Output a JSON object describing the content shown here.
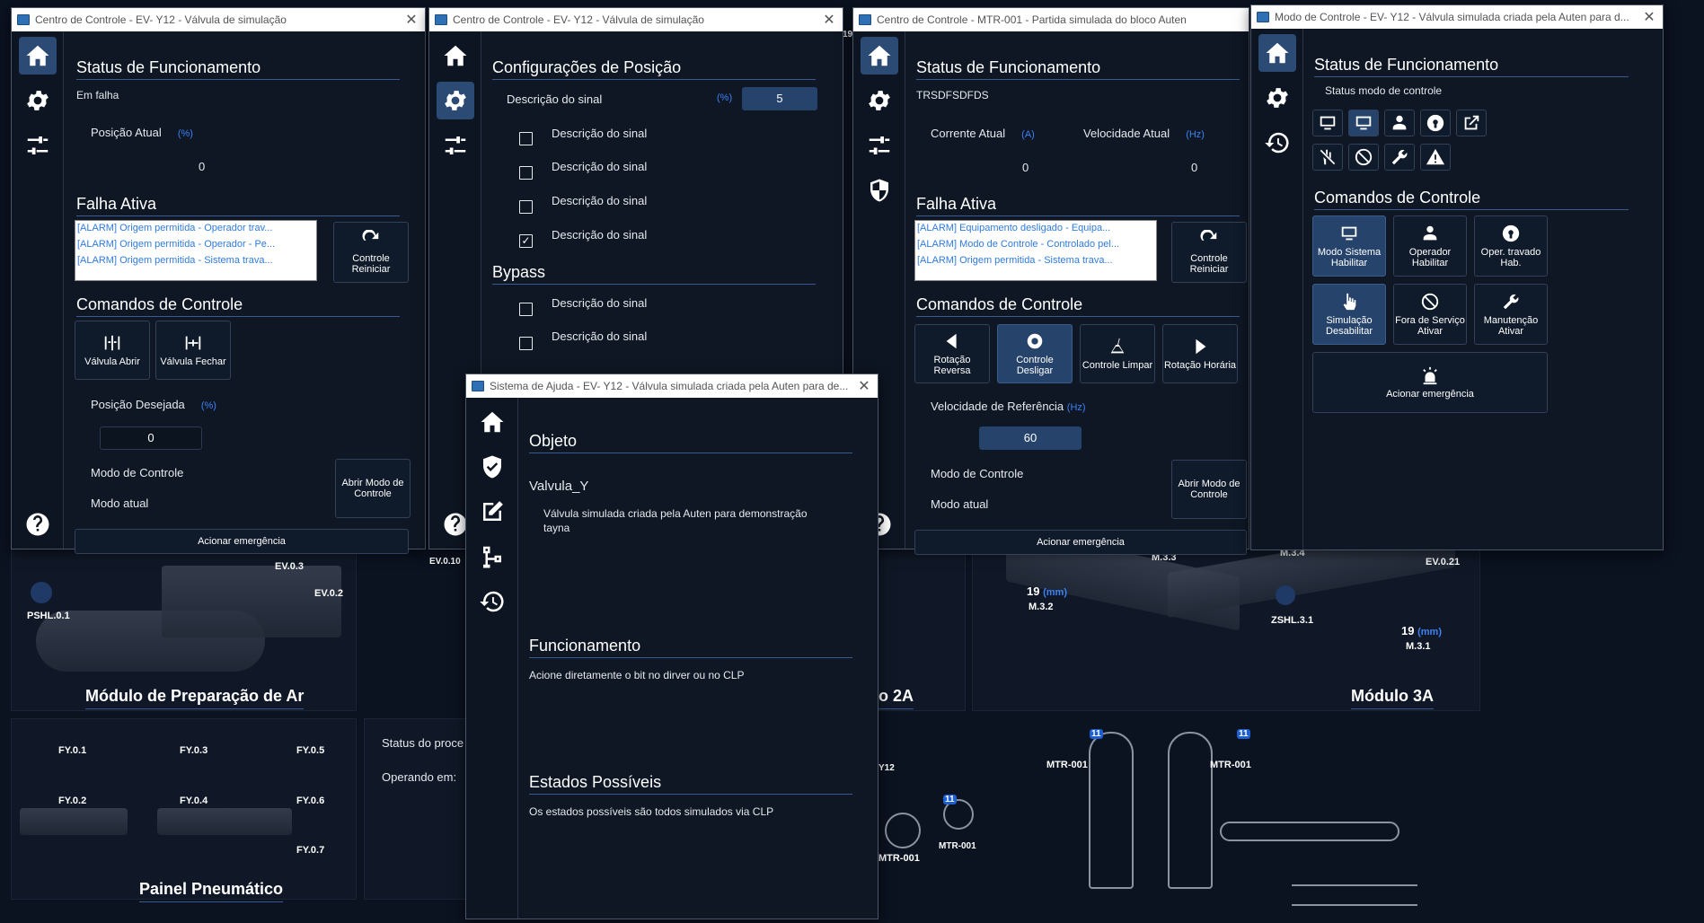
{
  "background": {
    "panels": [
      {
        "title": "Módulo de Preparação de Ar"
      },
      {
        "title": "Painel Pneumático"
      },
      {
        "title": "Módulo 3A"
      },
      {
        "title": "o 2A"
      }
    ],
    "tags": {
      "ev03": "EV.0.3",
      "ev02": "EV.0.2",
      "pshl01": "PSHL.0.1",
      "ev010": "EV.0.10",
      "fy01": "FY.0.1",
      "fy02": "FY.0.2",
      "fy03": "FY.0.3",
      "fy04": "FY.0.4",
      "fy05": "FY.0.5",
      "fy06": "FY.0.6",
      "fy07": "FY.0.7",
      "m33": "M.3.3",
      "m34": "M.3.4",
      "ev021": "EV.0.21",
      "m32": "M.3.2",
      "m31": "M.3.1",
      "zshl31": "ZSHL.3.1",
      "v19a": "19",
      "v19b": "19",
      "unit_mm": "(mm)",
      "mtr_a": "MTR-001",
      "mtr_b": "MTR-001",
      "mtr_c": "MTR-001",
      "mtr_d": "MTR-001",
      "badge": "11",
      "y12": "Y12",
      "n19": "19",
      "status_proc": "Status do proce",
      "operando": "Operando em:"
    }
  },
  "win1": {
    "title": "Centro de Controle - EV- Y12 - Válvula de simulação",
    "status_header": "Status de Funcionamento",
    "status_value": "Em falha",
    "pos_label": "Posição Atual",
    "pos_unit": "(%)",
    "pos_value": "0",
    "fault_header": "Falha Ativa",
    "alarms": [
      "[ALARM] Origem permitida - Operador trav...",
      "[ALARM] Origem permitida - Operador - Pe...",
      "[ALARM] Origem permitida - Sistema trava..."
    ],
    "reset_label": "Controle Reiniciar",
    "cmd_header": "Comandos de Controle",
    "btn_open": "Válvula Abrir",
    "btn_close": "Válvula Fechar",
    "desired_label": "Posição Desejada",
    "desired_unit": "(%)",
    "desired_value": "0",
    "mode_label": "Modo de Controle",
    "mode_current": "Modo atual",
    "mode_btn": "Abrir Modo de Controle",
    "emergency": "Acionar emergência"
  },
  "win2": {
    "title": "Centro de Controle - EV- Y12 - Válvula de simulação",
    "header": "Configurações de Posição",
    "signal_label": "Descrição do sinal",
    "signal_unit": "(%)",
    "signal_value": "5",
    "checks": [
      {
        "label": "Descrição do sinal",
        "checked": false
      },
      {
        "label": "Descrição do sinal",
        "checked": false
      },
      {
        "label": "Descrição do sinal",
        "checked": false
      },
      {
        "label": "Descrição do sinal",
        "checked": true
      }
    ],
    "bypass_header": "Bypass",
    "bypass": [
      {
        "label": "Descrição do sinal"
      },
      {
        "label": "Descrição do sinal"
      }
    ]
  },
  "win3": {
    "title": "Centro de Controle - MTR-001 - Partida simulada do bloco Auten",
    "status_header": "Status de Funcionamento",
    "status_value": "TRSDFSDFDS",
    "current_label": "Corrente Atual",
    "current_unit": "(A)",
    "current_value": "0",
    "speed_label": "Velocidade Atual",
    "speed_unit": "(Hz)",
    "speed_value": "0",
    "fault_header": "Falha Ativa",
    "alarms": [
      "[ALARM] Equipamento desligado - Equipa...",
      "[ALARM] Modo de Controle - Controlado pel...",
      "[ALARM] Origem permitida - Sistema trava..."
    ],
    "reset_label": "Controle Reiniciar",
    "cmd_header": "Comandos de Controle",
    "buttons": [
      "Rotação Reversa",
      "Controle Desligar",
      "Controle Limpar",
      "Rotação Horária"
    ],
    "ref_label": "Velocidade de Referência",
    "ref_unit": "(Hz)",
    "ref_value": "60",
    "mode_label": "Modo de Controle",
    "mode_current": "Modo atual",
    "mode_btn": "Abrir Modo de Controle",
    "emergency": "Acionar emergência"
  },
  "win4": {
    "title": "Modo de Controle - EV- Y12 - Válvula simulada criada pela Auten para d...",
    "status_header": "Status de Funcionamento",
    "status_value": "Status modo de controle",
    "cmd_header": "Comandos de Controle",
    "buttons": [
      "Modo Sistema Habilitar",
      "Operador Habilitar",
      "Oper. travado Hab.",
      "Simulação Desabilitar",
      "Fora de Serviço Ativar",
      "Manutenção Ativar"
    ],
    "emergency": "Acionar emergência"
  },
  "win5": {
    "title": "Sistema de Ajuda - EV- Y12 - Válvula simulada criada pela Auten para de...",
    "obj_header": "Objeto",
    "obj_name": "Valvula_Y",
    "obj_desc_1": "Válvula simulada criada pela Auten para demonstração",
    "obj_desc_2": "tayna",
    "func_header": "Funcionamento",
    "func_text": "Acione diretamente o bit no dirver ou no CLP",
    "states_header": "Estados Possíveis",
    "states_text": "Os estados possíveis são todos simulados via CLP"
  }
}
